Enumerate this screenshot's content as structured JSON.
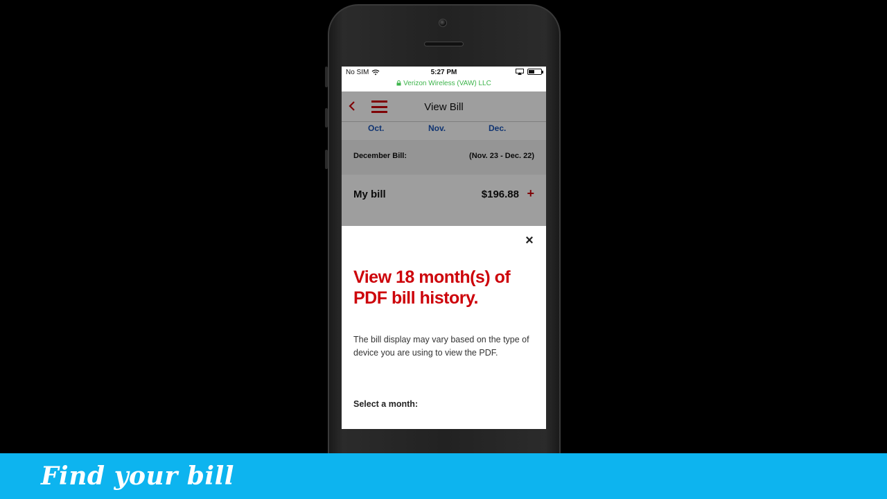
{
  "status_bar": {
    "carrier": "No SIM",
    "time": "5:27 PM",
    "url": "Verizon Wireless (VAW) LLC",
    "battery_level": 0.45
  },
  "nav": {
    "title": "View Bill"
  },
  "months": [
    "Oct.",
    "Nov.",
    "Dec."
  ],
  "bill_period": {
    "label": "December Bill:",
    "range": "(Nov. 23 - Dec. 22)"
  },
  "my_bill": {
    "label": "My bill",
    "amount": "$196.88",
    "expand": "+"
  },
  "modal": {
    "close": "×",
    "title": "View 18 month(s) of PDF bill history.",
    "description": "The bill display may vary based on the type of device you are using to view the PDF.",
    "select_label": "Select a month:"
  },
  "banner": {
    "caption": "Find your bill"
  },
  "colors": {
    "brand_red": "#cd040b",
    "month_blue": "#1a55b8",
    "banner_blue": "#0db4ef",
    "secure_green": "#3cb44a"
  },
  "icons": [
    "back-chevron-icon",
    "hamburger-menu-icon",
    "close-icon",
    "wifi-icon",
    "lock-icon",
    "airplay-icon",
    "battery-icon"
  ]
}
